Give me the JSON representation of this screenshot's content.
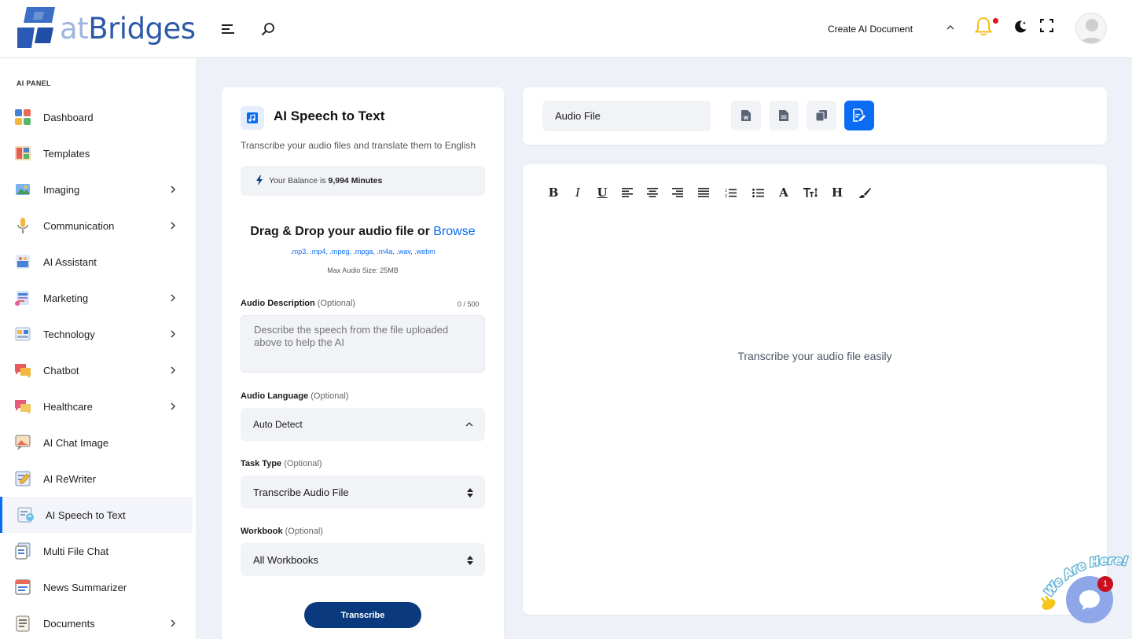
{
  "brand": {
    "logo_prefix": "at",
    "logo_suffix": "Bridges"
  },
  "header": {
    "create_label": "Create AI Document",
    "colors": {
      "bell": "#f5b800",
      "notification_dot": "#e3101e"
    }
  },
  "sidebar": {
    "section_label": "AI PANEL",
    "items": [
      {
        "label": "Dashboard",
        "icon": "dashboard-icon",
        "has_children": false
      },
      {
        "label": "Templates",
        "icon": "templates-icon",
        "has_children": false
      },
      {
        "label": "Imaging",
        "icon": "imaging-icon",
        "has_children": true
      },
      {
        "label": "Communication",
        "icon": "microphone-icon",
        "has_children": true
      },
      {
        "label": "AI Assistant",
        "icon": "assistant-icon",
        "has_children": false
      },
      {
        "label": "Marketing",
        "icon": "marketing-icon",
        "has_children": true
      },
      {
        "label": "Technology",
        "icon": "technology-icon",
        "has_children": true
      },
      {
        "label": "Chatbot",
        "icon": "chatbot-icon",
        "has_children": true
      },
      {
        "label": "Healthcare",
        "icon": "healthcare-icon",
        "has_children": true
      },
      {
        "label": "AI Chat Image",
        "icon": "chat-image-icon",
        "has_children": false
      },
      {
        "label": "AI ReWriter",
        "icon": "rewriter-icon",
        "has_children": false
      },
      {
        "label": "AI Speech to Text",
        "icon": "speech-to-text-icon",
        "has_children": false,
        "active": true
      },
      {
        "label": "Multi File Chat",
        "icon": "multi-file-icon",
        "has_children": false
      },
      {
        "label": "News Summarizer",
        "icon": "news-icon",
        "has_children": false
      },
      {
        "label": "Documents",
        "icon": "documents-icon",
        "has_children": true
      }
    ]
  },
  "form": {
    "title": "AI Speech to Text",
    "subtitle": "Transcribe your audio files and translate them to English",
    "balance_prefix": "Your Balance is",
    "balance_value": "9,994 Minutes",
    "drop_text": "Drag & Drop your audio file or",
    "browse_label": "Browse",
    "formats": ".mp3, .mp4, .mpeg, .mpga, .m4a, .wav, .webm",
    "max_size": "Max Audio Size: 25MB",
    "optional_label": "(Optional)",
    "description": {
      "label": "Audio Description",
      "counter": "0 / 500",
      "placeholder": "Describe the speech from the file uploaded above to help the AI"
    },
    "language": {
      "label": "Audio Language",
      "value": "Auto Detect"
    },
    "task_type": {
      "label": "Task Type",
      "value": "Transcribe Audio File"
    },
    "workbook": {
      "label": "Workbook",
      "value": "All Workbooks"
    },
    "submit_label": "Transcribe",
    "colors": {
      "accent": "#0a6cf2",
      "submit": "#0a3a7d"
    }
  },
  "output": {
    "file_title_value": "Audio File",
    "empty_message": "Transcribe your audio file easily",
    "export_buttons": [
      "export-word-icon",
      "export-text-icon",
      "copy-icon",
      "save-edit-icon"
    ],
    "toolbar": [
      "bold-icon",
      "italic-icon",
      "underline-icon",
      "align-left-icon",
      "align-center-icon",
      "align-right-icon",
      "align-justify-icon",
      "ordered-list-icon",
      "unordered-list-icon",
      "font-color-icon",
      "font-size-icon",
      "heading-icon",
      "brush-icon"
    ],
    "toolbar_glyphs": {
      "bold": "B",
      "italic": "I",
      "underline": "U",
      "font_color": "A",
      "heading": "H"
    }
  },
  "chat_widget": {
    "banner": "We Are Here!",
    "badge_count": "1"
  }
}
